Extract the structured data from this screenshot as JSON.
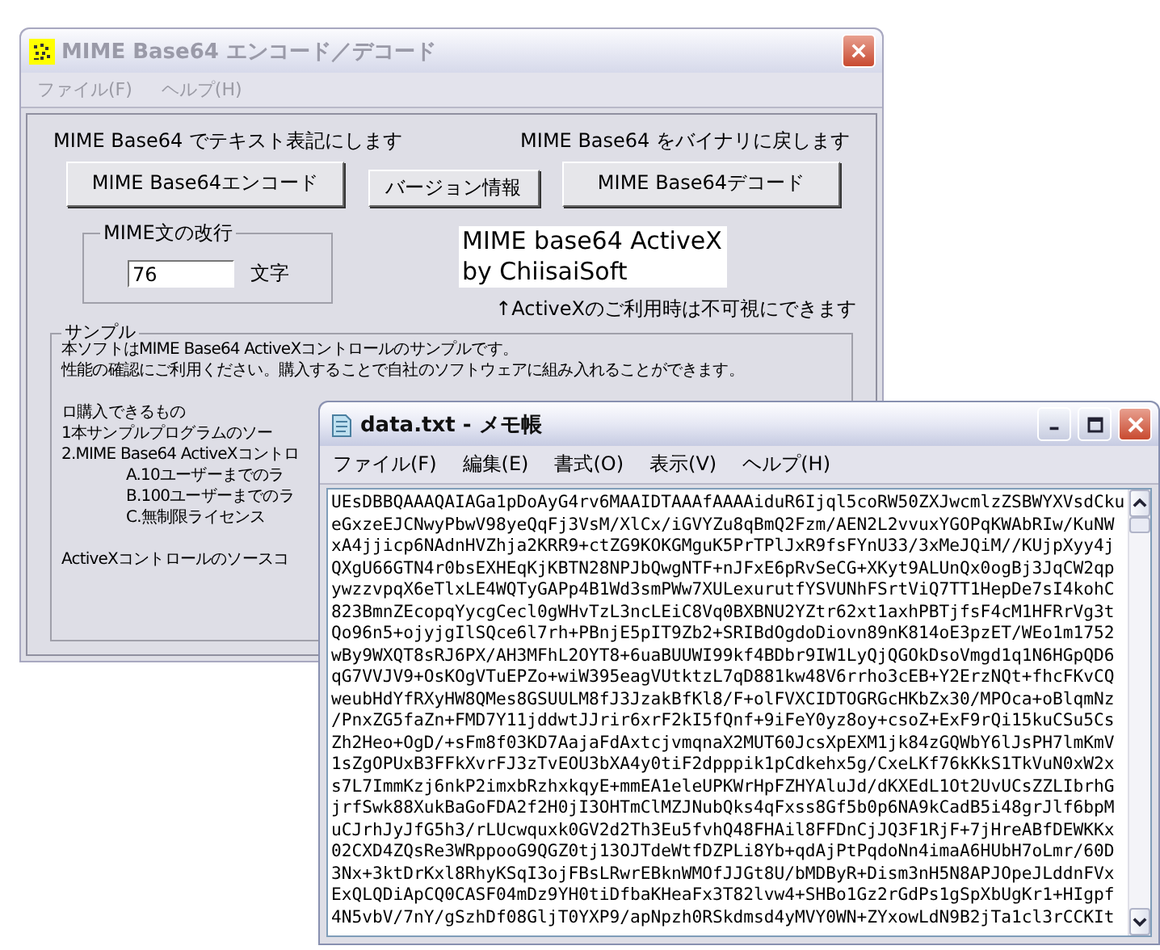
{
  "main_window": {
    "title": "MIME Base64 エンコード／デコード",
    "active": false,
    "menu": [
      {
        "label": "ファイル(F)",
        "disabled": true
      },
      {
        "label": "ヘルプ(H)",
        "disabled": true
      }
    ],
    "encode_caption": "MIME Base64 でテキスト表記にします",
    "decode_caption": "MIME Base64 をバイナリに戻します",
    "buttons": [
      {
        "label": "MIME Base64エンコード",
        "kind": "wide"
      },
      {
        "label": "バージョン情報",
        "kind": "small"
      },
      {
        "label": "MIME Base64デコード",
        "kind": "wide"
      }
    ],
    "line_break": {
      "title": "MIME文の改行",
      "value": "76",
      "unit": "文字"
    },
    "activex_label": [
      "MIME base64 ActiveX",
      "by ChiisaiSoft"
    ],
    "activex_note": "↑ActiveXのご利用時は不可視にできます",
    "sample": {
      "title": "サンプル",
      "paragraphs": [
        [
          {
            "kind": "text",
            "text": "本ソフトはMIME Base64 ActiveXコントロールのサンプルです。"
          },
          {
            "kind": "text",
            "text": "性能の確認にご利用ください。購入することで自社のソフトウェアに組み入れることができます。"
          }
        ],
        [
          {
            "kind": "text",
            "text": "ロ購入できるもの"
          },
          {
            "kind": "text",
            "text": "1本サンプルプログラムのソー"
          },
          {
            "kind": "text",
            "text": "2.MIME Base64 ActiveXコントロ"
          },
          {
            "kind": "indent",
            "text": "A.10ユーザーまでのラ"
          },
          {
            "kind": "indent",
            "text": "B.100ユーザーまでのラ"
          },
          {
            "kind": "indent",
            "text": "C.無制限ライセンス"
          }
        ],
        [
          {
            "kind": "text",
            "text": "ActiveXコントロールのソースコ"
          }
        ]
      ]
    }
  },
  "notepad": {
    "title": "data.txt - メモ帳",
    "active": true,
    "menu": [
      "ファイル(F)",
      "編集(E)",
      "書式(O)",
      "表示(V)",
      "ヘルプ(H)"
    ],
    "lines": [
      "UEsDBBQAAAQAIAGa1pDoAyG4rv6MAAIDTAAAfAAAAiduR6Ijql5coRW50ZXJwcmlzZSBWYXVsdCku",
      "eGxzeEJCNwyPbwV98yeQqFj3VsM/XlCx/iGVYZu8qBmQ2Fzm/AEN2L2vvuxYGOPqKWAbRIw/KuNW",
      "xA4jjicp6NAdnHVZhja2KRR9+ctZG9KOKGMguK5PrTPlJxR9fsFYnU33/3xMeJQiM//KUjpXyy4j",
      "QXgU66GTN4r0bsEXHEqKjKBTN28NPJbQwgNTF+nJFxE6pRvSeCG+XKyt9ALUnQx0ogBj3JqCW2qp",
      "ywzzvpqX6eTlxLE4WQTyGAPp4B1Wd3smPWw7XULexurutfYSVUNhFSrtViQ7TT1HepDe7sI4kohC",
      "823BmnZEcopqYycgCecl0gWHvTzL3ncLEiC8Vq0BXBNU2YZtr62xt1axhPBTjfsF4cM1HFRrVg3t",
      "Qo96n5+ojyjgIlSQce6l7rh+PBnjE5pIT9Zb2+SRIBdOgdoDiovn89nK814oE3pzET/WEo1m1752",
      "wBy9WXQT8sRJ6PX/AH3MFhL2OYT8+6uaBUUWI99kf4BDbr9IW1LyQjQGOkDsoVmgd1q1N6HGpQD6",
      "qG7VVJV9+OsKOgVTuEPZo+wiW395eagVUtktzL7qD881kw48V6rrho3cEB+Y2ErzNQt+fhcFKvCQ",
      "weubHdYfRXyHW8QMes8GSUULM8fJ3JzakBfKl8/F+olFVXCIDTOGRGcHKbZx30/MPOca+oBlqmNz",
      "/PnxZG5faZn+FMD7Y11jddwtJJrir6xrF2kI5fQnf+9iFeY0yz8oy+csoZ+ExF9rQi15kuCSu5Cs",
      "Zh2Heo+OgD/+sFm8f03KD7AajaFdAxtcjvmqnaX2MUT60JcsXpEXM1jk84zGQWbY6lJsPH7lmKmV",
      "1sZgOPUxB3FFkXvrFJ3zTvEOU3bXA4y0tiF2dpppik1pCdkehx5g/CxeLKf76kKkS1TkVuN0xW2x",
      "s7L7ImmKzj6nkP2imxbRzhxkqyE+mmEA1eleUPKWrHpFZHYAluJd/dKXEdL1Ot2UvUCsZZLIbrhG",
      "jrfSwk88XukBaGoFDA2f2H0jI3OHTmClMZJNubQks4qFxss8Gf5b0p6NA9kCadB5i48grJlf6bpM",
      "uCJrhJyJfG5h3/rLUcwquxk0GV2d2Th3Eu5fvhQ48FHAil8FFDnCjJQ3F1RjF+7jHreABfDEWKKx",
      "02CXD4ZQsRe3WRppooG9QGZ0tj13OJTdeWtfDZPLi8Yb+qdAjPtPqdoNn4imaA6HUbH7oLmr/60D",
      "3Nx+3ktDrKxl8RhyKSqI3ojFBsLRwrEBknWMOfJJGt8U/bMDByR+Dism3nH5N8APJOpeJLddnFVx",
      "ExQLQDiApCQ0CASF04mDz9YH0tiDfbaKHeaFx3T82lvw4+SHBo1Gz2rGdPs1gSpXbUgKr1+HIgpf",
      "4N5vbV/7nY/gSzhDf08GljT0YXP9/apNpzh0RSkdmsd4yMVY0WN+ZYxowLdN9B2jTa1cl3rCCKIt"
    ]
  }
}
